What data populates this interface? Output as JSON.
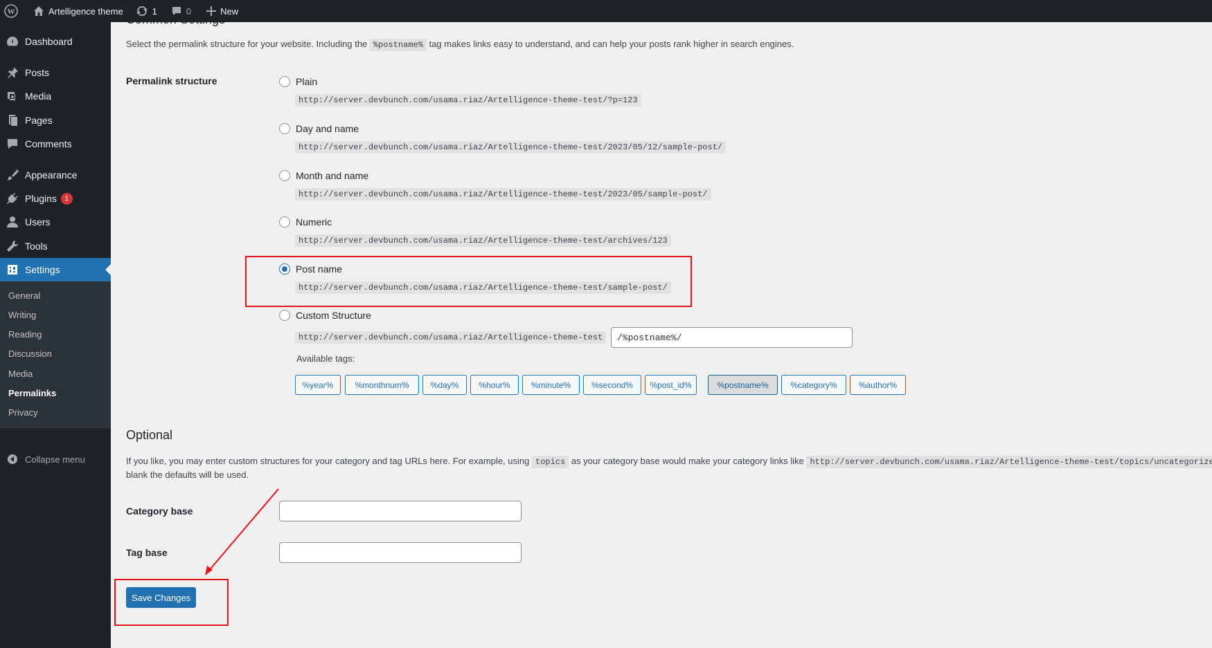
{
  "adminbar": {
    "site_name": "Artelligence theme",
    "updates_count": "1",
    "comments_count": "0",
    "new_label": "New"
  },
  "sidebar": {
    "items": [
      {
        "label": "Dashboard",
        "icon": "dashboard-icon"
      },
      {
        "label": "Posts",
        "icon": "pin-icon"
      },
      {
        "label": "Media",
        "icon": "media-icon"
      },
      {
        "label": "Pages",
        "icon": "pages-icon"
      },
      {
        "label": "Comments",
        "icon": "comment-icon"
      },
      {
        "label": "Appearance",
        "icon": "brush-icon"
      },
      {
        "label": "Plugins",
        "icon": "plugin-icon",
        "badge": "1"
      },
      {
        "label": "Users",
        "icon": "user-icon"
      },
      {
        "label": "Tools",
        "icon": "wrench-icon"
      },
      {
        "label": "Settings",
        "icon": "settings-icon",
        "current": true
      }
    ],
    "submenu": [
      "General",
      "Writing",
      "Reading",
      "Discussion",
      "Media",
      "Permalinks",
      "Privacy"
    ],
    "submenu_current": "Permalinks",
    "collapse_label": "Collapse menu"
  },
  "common": {
    "heading": "Common Settings",
    "desc_before": "Select the permalink structure for your website. Including the",
    "desc_code": "%postname%",
    "desc_after": "tag makes links easy to understand, and can help your posts rank higher in search engines.",
    "structure_label": "Permalink structure",
    "options": [
      {
        "label": "Plain",
        "url": "http://server.devbunch.com/usama.riaz/Artelligence-theme-test/?p=123"
      },
      {
        "label": "Day and name",
        "url": "http://server.devbunch.com/usama.riaz/Artelligence-theme-test/2023/05/12/sample-post/"
      },
      {
        "label": "Month and name",
        "url": "http://server.devbunch.com/usama.riaz/Artelligence-theme-test/2023/05/sample-post/"
      },
      {
        "label": "Numeric",
        "url": "http://server.devbunch.com/usama.riaz/Artelligence-theme-test/archives/123"
      },
      {
        "label": "Post name",
        "url": "http://server.devbunch.com/usama.riaz/Artelligence-theme-test/sample-post/",
        "checked": true
      },
      {
        "label": "Custom Structure",
        "url": "http://server.devbunch.com/usama.riaz/Artelligence-theme-test"
      }
    ],
    "custom_value": "/%postname%/",
    "available_tags_label": "Available tags:",
    "tags": [
      "%year%",
      "%monthnum%",
      "%day%",
      "%hour%",
      "%minute%",
      "%second%",
      "%post_id%",
      "%postname%",
      "%category%",
      "%author%"
    ],
    "active_tag": "%postname%"
  },
  "optional": {
    "title": "Optional",
    "desc_before": "If you like, you may enter custom structures for your category and tag URLs here. For example, using",
    "desc_code1": "topics",
    "desc_middle": "as your category base would make your category links like",
    "desc_code2": "http://server.devbunch.com/usama.riaz/Artelligence-theme-test/topics/uncategorized/",
    "desc_line2": "blank the defaults will be used.",
    "category_label": "Category base",
    "category_value": "",
    "tag_label": "Tag base",
    "tag_value": ""
  },
  "save_label": "Save Changes",
  "colors": {
    "accent": "#2271b1",
    "annotation": "#e0121a",
    "sidebar_bg": "#1d2327"
  }
}
